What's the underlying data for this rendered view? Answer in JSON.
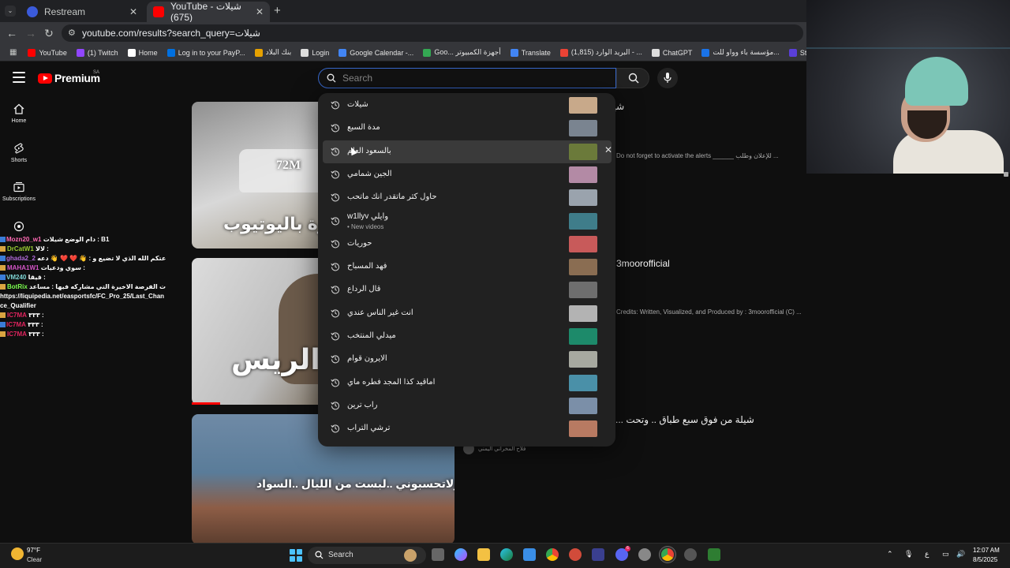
{
  "browser": {
    "tabs": [
      {
        "title": "Restream",
        "favicon_color": "#3b5bdb"
      },
      {
        "title": "YouTube - شيلات (675)",
        "favicon_color": "#ff0000"
      }
    ],
    "new_tab": "+",
    "url": "youtube.com/results?search_query=شيلات",
    "bookmarks": [
      {
        "label": "YouTube",
        "color": "#ff0000"
      },
      {
        "label": "(1) Twitch",
        "color": "#9146ff"
      },
      {
        "label": "Home",
        "color": "#ffffff"
      },
      {
        "label": "Log in to your PayP...",
        "color": "#0070e0"
      },
      {
        "label": "بنك البلاد",
        "color": "#e6a100"
      },
      {
        "label": "Login",
        "color": "#dddddd"
      },
      {
        "label": "Google Calendar -...",
        "color": "#4285f4"
      },
      {
        "label": "Goo... أجهزة الكمبيوتر",
        "color": "#34a853"
      },
      {
        "label": "Translate",
        "color": "#4285f4"
      },
      {
        "label": "(1,815) البريد الوارد - ...",
        "color": "#ea4335"
      },
      {
        "label": "ChatGPT",
        "color": "#dddddd"
      },
      {
        "label": "مؤسسة باء وواو للت...",
        "color": "#1a73e8"
      },
      {
        "label": "StreamElements - M...",
        "color": "#5a3fd8"
      }
    ]
  },
  "youtube": {
    "logo_text": "Premium",
    "country_code": "SA",
    "search_placeholder": "Search",
    "guide": [
      {
        "label": "Home",
        "icon": "home-icon"
      },
      {
        "label": "Shorts",
        "icon": "shorts-icon"
      },
      {
        "label": "Subscriptions",
        "icon": "subscriptions-icon"
      }
    ],
    "results": [
      {
        "title": "شيـ",
        "desc": "Do not forget to activate the alerts ______ للإعلان وطلب ...",
        "thumb_caption_a": "72M",
        "thumb_caption_b": "هرة باليوتيوب"
      },
      {
        "title": "3moorofficial",
        "desc": "Credits: Written, Visualized, and Produced by : 3moorofficial (C) ...",
        "thumb_caption_a": "الريس",
        "thumb_caption_b": ""
      },
      {
        "title": "شيلة من فوق سبع طباق .. وتحت ...",
        "channel": "فلاح المخراني اليمني",
        "thumb_caption_a": "ولاتحسبوني ..لبست من الليال ..السواد",
        "thumb_caption_b": ""
      }
    ],
    "suggestions": [
      {
        "text": "شيلات",
        "sub": "",
        "thumb_color": "#c8a98a"
      },
      {
        "text": "مدة السبع",
        "sub": "",
        "thumb_color": "#7a8490"
      },
      {
        "text": "بالسعود العلم",
        "sub": "",
        "thumb_color": "#6b7a3a",
        "hovered": true
      },
      {
        "text": "الجين شمامي",
        "sub": "",
        "thumb_color": "#b38aa5"
      },
      {
        "text": "حاول كثر ماتقدر انك ماتحب",
        "sub": "",
        "thumb_color": "#9aa3ad"
      },
      {
        "text": "w1llyv وايلي",
        "sub": "• New videos",
        "thumb_color": "#3f7d8a"
      },
      {
        "text": "حوريات",
        "sub": "",
        "thumb_color": "#c85a5a"
      },
      {
        "text": "فهد المسباح",
        "sub": "",
        "thumb_color": "#8a6d52"
      },
      {
        "text": "قال الرداع",
        "sub": "",
        "thumb_color": "#6e6e6e"
      },
      {
        "text": "انت غير الناس عندي",
        "sub": "",
        "thumb_color": "#b3b3b3"
      },
      {
        "text": "ميدلي المنتخب",
        "sub": "",
        "thumb_color": "#1d8a6a"
      },
      {
        "text": "الايرون قوام",
        "sub": "",
        "thumb_color": "#a7a9a0"
      },
      {
        "text": "اماقيد كذا المجد فطره ماي",
        "sub": "",
        "thumb_color": "#4a90a8"
      },
      {
        "text": "راب ترين",
        "sub": "",
        "thumb_color": "#7b8fa8"
      },
      {
        "text": "ترشي التراب",
        "sub": "",
        "thumb_color": "#b87a62"
      }
    ],
    "remove_suggestion": "✕"
  },
  "chat": [
    {
      "user": "Mozn20_w1",
      "color": "#ff69b4",
      "msg": "دام الوضع شيلات : B1"
    },
    {
      "user": "DrCatW1",
      "color": "#9acd32",
      "msg": "لالا :"
    },
    {
      "user": "ghada2_2",
      "color": "#b06ad9",
      "msg": "ياقلة مع السلامه استودعتكم الله الذي لا تضيع و : 👋 ❤️ ❤️ 👋 دعه"
    },
    {
      "user": "MAHA1W1",
      "color": "#d655c9",
      "msg": "سوي ودعيات :"
    },
    {
      "user": "VM240",
      "color": "#7fd6d6",
      "msg": "قيقا :"
    },
    {
      "user": "BotRix",
      "color": "#7cff4f",
      "msg": "جدول تصفيات الفرصة الاخيرة التي مشاركه فيها : مساعد"
    },
    {
      "user": "",
      "color": "#ffffff",
      "msg": "https://liquipedia.net/easportsfc/FC_Pro_25/Last_Chance_Qualifier"
    },
    {
      "user": "IC7MA",
      "color": "#e0245e",
      "msg": "٣٣٣ :"
    },
    {
      "user": "IC7MA",
      "color": "#e0245e",
      "msg": "٣٣٣ :"
    },
    {
      "user": "IC7MA",
      "color": "#e0245e",
      "msg": "٣٣٣ :"
    }
  ],
  "taskbar": {
    "weather_temp": "97°F",
    "weather_desc": "Clear",
    "search_label": "Search",
    "ime": "ع",
    "time": "12:07 AM",
    "date": "8/5/2025",
    "discord_badge": "6"
  }
}
